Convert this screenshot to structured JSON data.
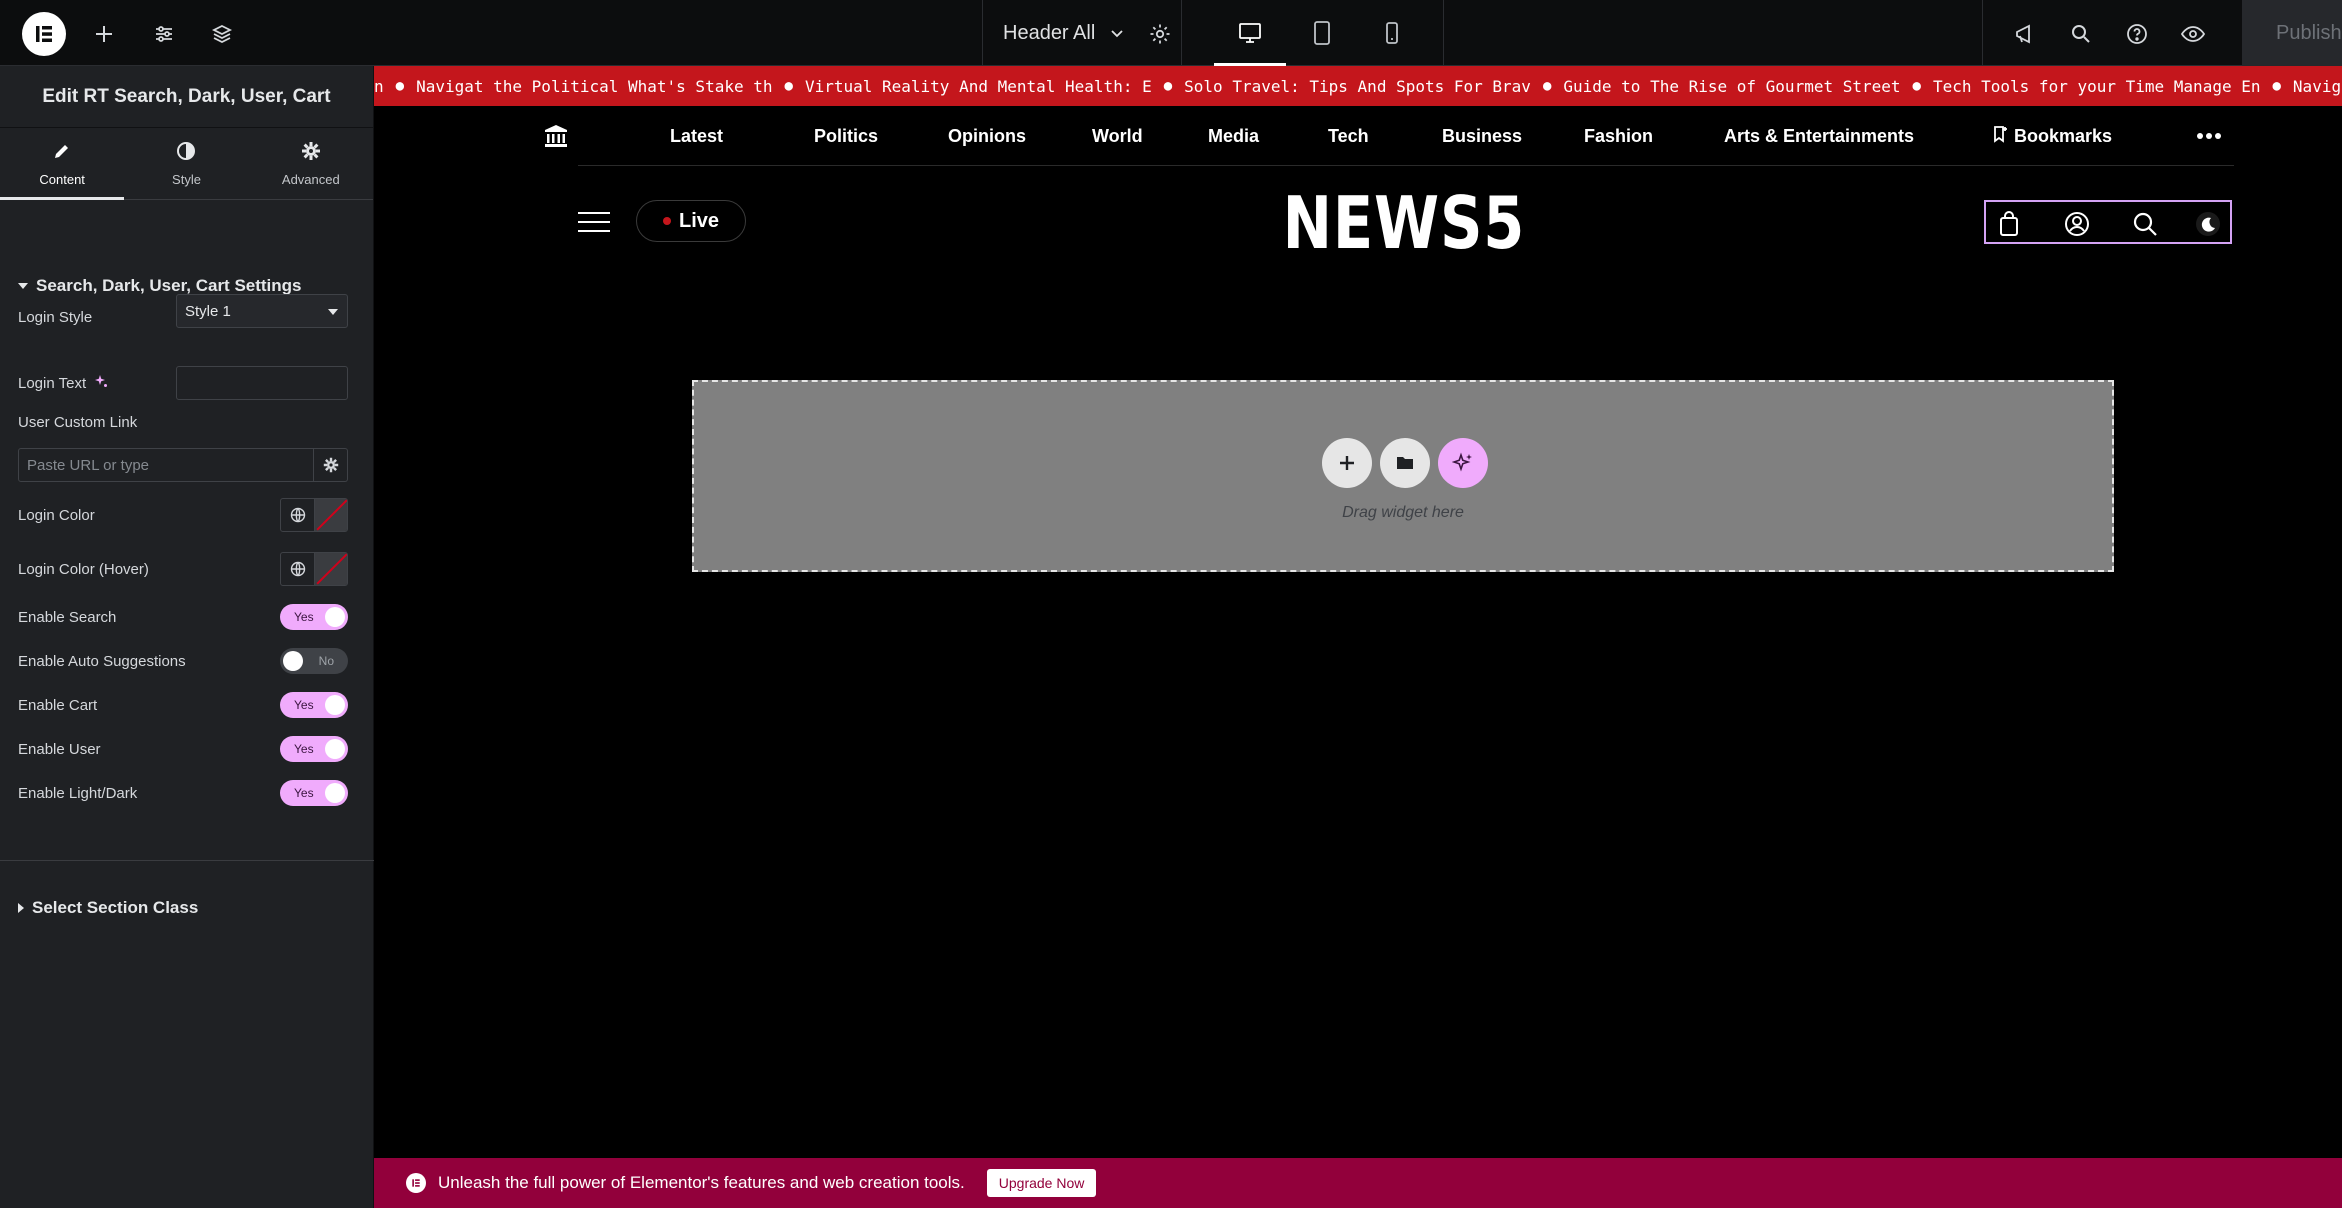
{
  "topbar": {
    "document_title": "Header All",
    "publish_label": "Publish"
  },
  "panel": {
    "title": "Edit RT Search, Dark, User, Cart",
    "tabs": [
      {
        "label": "Content",
        "icon": "pencil-icon"
      },
      {
        "label": "Style",
        "icon": "contrast-icon"
      },
      {
        "label": "Advanced",
        "icon": "gear-icon"
      }
    ],
    "section_title": "Search, Dark, User, Cart Settings",
    "login_style_label": "Login Style",
    "login_style_value": "Style 1",
    "login_text_label": "Login Text",
    "login_text_value": "",
    "user_custom_link_label": "User Custom Link",
    "url_placeholder": "Paste URL or type",
    "login_color_label": "Login Color",
    "login_color_hover_label": "Login Color (Hover)",
    "toggles": [
      {
        "label": "Enable Search",
        "state": "Yes"
      },
      {
        "label": "Enable Auto Suggestions",
        "state": "No"
      },
      {
        "label": "Enable Cart",
        "state": "Yes"
      },
      {
        "label": "Enable User",
        "state": "Yes"
      },
      {
        "label": "Enable Light/Dark",
        "state": "Yes"
      }
    ],
    "section2_title": "Select Section Class"
  },
  "canvas": {
    "ticker": [
      "n",
      "Navigat the Political What's Stake th",
      "Virtual Reality And Mental Health: E",
      "Solo Travel: Tips And Spots For Brav",
      "Guide to The Rise of Gourmet Street",
      "Tech Tools for your Time Manage En",
      "Navigat the Political W"
    ],
    "nav": [
      "Latest",
      "Politics",
      "Opinions",
      "World",
      "Media",
      "Tech",
      "Business",
      "Fashion",
      "Arts & Entertainments",
      "Bookmarks"
    ],
    "live_label": "Live",
    "logo_text": "NEWS5",
    "drop_hint": "Drag widget here"
  },
  "promo": {
    "text": "Unleash the full power of Elementor's features and web creation tools.",
    "button": "Upgrade Now"
  },
  "colors": {
    "accent_pink": "#f0abfc",
    "ticker_red": "#c4161c",
    "promo_bg": "#92003b",
    "panel_bg": "#1f2124"
  }
}
